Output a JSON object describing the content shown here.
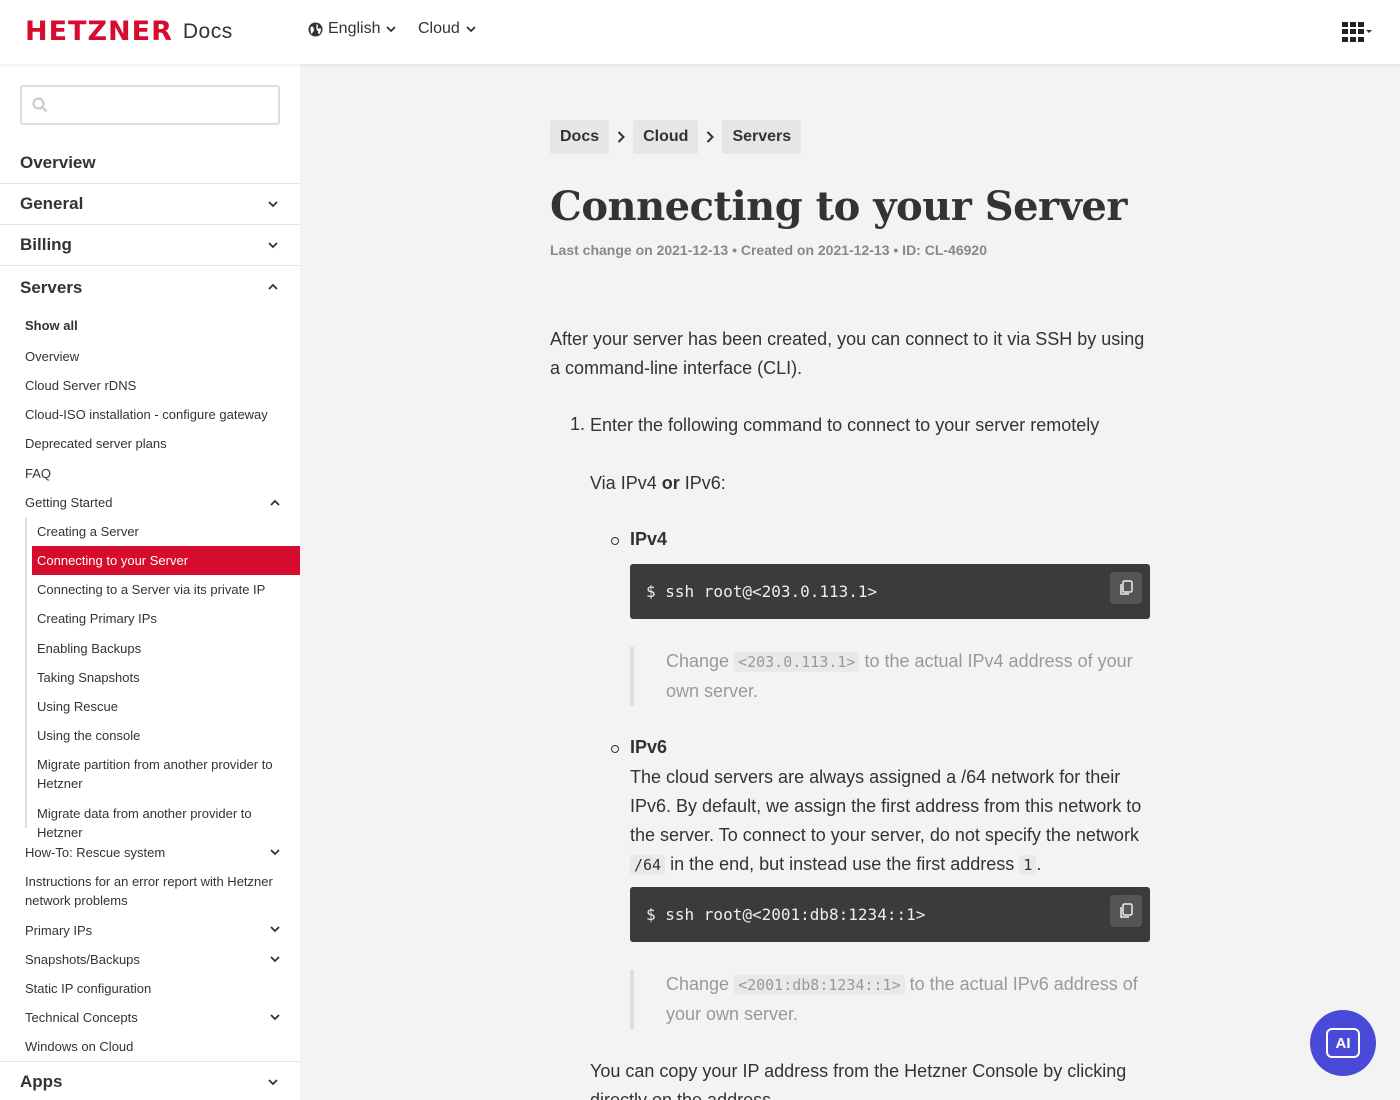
{
  "header": {
    "logo_text": "HETZNER",
    "logo_docs": "Docs",
    "language": "English",
    "product": "Cloud",
    "apps_icon": "apps-grid-icon"
  },
  "sidebar": {
    "search_placeholder": "",
    "sections": {
      "overview": "Overview",
      "general": "General",
      "billing": "Billing",
      "servers": "Servers",
      "apps": "Apps"
    },
    "servers_items": {
      "show_all": "Show all",
      "overview": "Overview",
      "rdns": "Cloud Server rDNS",
      "cloud_iso": "Cloud-ISO installation - configure gateway",
      "deprecated": "Deprecated server plans",
      "faq": "FAQ",
      "getting_started": "Getting Started",
      "how_to_rescue": "How-To: Rescue system",
      "instructions_error": "Instructions for an error report with Hetzner network problems",
      "primary_ips": "Primary IPs",
      "snapshots_backups": "Snapshots/Backups",
      "static_ip": "Static IP configuration",
      "technical_concepts": "Technical Concepts",
      "windows": "Windows on Cloud"
    },
    "getting_started_children": {
      "creating_server": "Creating a Server",
      "connecting": "Connecting to your Server",
      "connecting_private": "Connecting to a Server via its private IP",
      "creating_primary_ips": "Creating Primary IPs",
      "enabling_backups": "Enabling Backups",
      "taking_snapshots": "Taking Snapshots",
      "using_rescue": "Using Rescue",
      "using_console": "Using the console",
      "migrate_partition": "Migrate partition from another provider to Hetzner",
      "migrate_data": "Migrate data from another provider to Hetzner"
    }
  },
  "breadcrumbs": {
    "docs": "Docs",
    "cloud": "Cloud",
    "servers": "Servers"
  },
  "article": {
    "title": "Connecting to your Server",
    "meta": "Last change on 2021-12-13 • Created on 2021-12-13 • ID: CL-46920",
    "intro": "After your server has been created, you can connect to it via SSH by using a command-line interface (CLI).",
    "step1_number": "1.",
    "step1": "Enter the following command to connect to your server remotely",
    "via_prefix": "Via IPv4 ",
    "via_or": "or",
    "via_suffix": " IPv6:",
    "ipv4_label": "IPv4",
    "ipv4_command": "$ ssh root@<203.0.113.1>",
    "ipv4_note_prefix": "Change ",
    "ipv4_note_code": "<203.0.113.1>",
    "ipv4_note_suffix": " to the actual IPv4 address of your own server.",
    "ipv6_label": "IPv6",
    "ipv6_text_1": "The cloud servers are always assigned a /64 network for their IPv6. By default, we assign the first address from this network to the server. To connect to your server, do not specify the network ",
    "ipv6_code_1": "/64",
    "ipv6_text_2": " in the end, but instead use the first address ",
    "ipv6_code_2": "1",
    "ipv6_text_3": ".",
    "ipv6_command": "$ ssh root@<2001:db8:1234::1>",
    "ipv6_note_prefix": "Change ",
    "ipv6_note_code": "<2001:db8:1234::1>",
    "ipv6_note_suffix": " to the actual IPv6 address of your own server.",
    "copy_note": "You can copy your IP address from the Hetzner Console by clicking directly on the address."
  },
  "ai_button": "AI",
  "colors": {
    "brand_red": "#d50c2d",
    "ai_purple": "#4a4ad8",
    "code_bg": "#3b3b3b"
  }
}
